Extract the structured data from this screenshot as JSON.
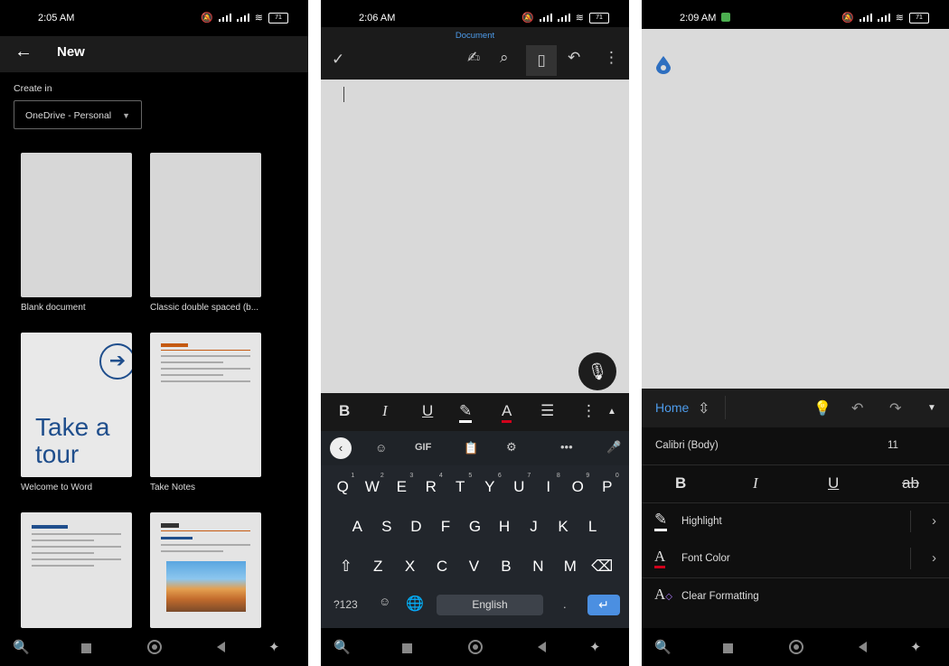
{
  "panel1": {
    "status_time": "2:05 AM",
    "battery": "71",
    "title": "New",
    "create_in_label": "Create in",
    "location": "OneDrive - Personal",
    "templates": [
      {
        "label": "Blank document"
      },
      {
        "label": "Classic double spaced (b..."
      },
      {
        "label": "Welcome to Word",
        "preview_text": "Take a tour"
      },
      {
        "label": "Take Notes"
      },
      {
        "label": ""
      },
      {
        "label": ""
      }
    ]
  },
  "panel2": {
    "status_time": "2:06 AM",
    "battery": "71",
    "doc_title": "Document",
    "format_bar": {
      "bold": "B",
      "italic": "I",
      "underline": "U",
      "font_color": "A"
    },
    "keyboard": {
      "row1": [
        "Q",
        "W",
        "E",
        "R",
        "T",
        "Y",
        "U",
        "I",
        "O",
        "P"
      ],
      "row1_hints": [
        "1",
        "2",
        "3",
        "4",
        "5",
        "6",
        "7",
        "8",
        "9",
        "0"
      ],
      "row2": [
        "A",
        "S",
        "D",
        "F",
        "G",
        "H",
        "J",
        "K",
        "L"
      ],
      "row3": [
        "Z",
        "X",
        "C",
        "V",
        "B",
        "N",
        "M"
      ],
      "gif": "GIF",
      "symbols": "?123",
      "space": "English",
      "period": "."
    }
  },
  "panel3": {
    "status_time": "2:09 AM",
    "battery": "71",
    "ribbon_tab": "Home",
    "font_name": "Calibri (Body)",
    "font_size": "11",
    "styles": {
      "bold": "B",
      "italic": "I",
      "underline": "U",
      "strike": "ab"
    },
    "options": [
      {
        "label": "Highlight"
      },
      {
        "label": "Font Color"
      },
      {
        "label": "Clear Formatting"
      }
    ]
  },
  "colors": {
    "accent": "#4d9bea",
    "font_red": "#d0021b",
    "tour_blue": "#1f4e8c",
    "enter_blue": "#4b8fe1"
  }
}
